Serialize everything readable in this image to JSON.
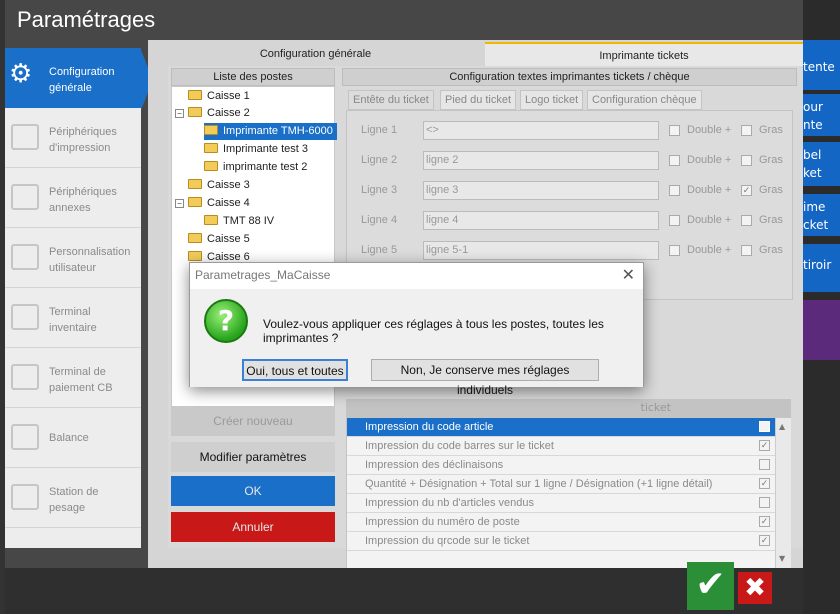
{
  "window": {
    "title": "Paramétrages"
  },
  "nav": [
    {
      "label": "Configuration générale",
      "icon": "gear-icon"
    },
    {
      "label": "Périphériques d'impression",
      "icon": "printer-icon"
    },
    {
      "label": "Périphériques annexes",
      "icon": "device-icon"
    },
    {
      "label": "Personnalisation utilisateur",
      "icon": "user-icon"
    },
    {
      "label": "Terminal inventaire",
      "icon": "terminal-icon"
    },
    {
      "label": "Terminal de paiement CB",
      "icon": "card-terminal-icon"
    },
    {
      "label": "Balance",
      "icon": "scale-icon"
    },
    {
      "label": "Station de pesage",
      "icon": "weigh-station-icon"
    }
  ],
  "tabs": {
    "tab1": "Configuration générale",
    "tab2": "Imprimante tickets"
  },
  "tree": {
    "header": "Liste des postes",
    "nodes": [
      "Caisse 1",
      "Caisse 2",
      "Imprimante TMH-6000",
      "Imprimante test 3",
      "imprimante test 2",
      "Caisse 3",
      "Caisse 4",
      "TMT 88 IV",
      "Caisse 5",
      "Caisse 6"
    ]
  },
  "buttons": {
    "create": "Créer nouveau",
    "modify": "Modifier paramètres",
    "ok": "OK",
    "cancel": "Annuler"
  },
  "config": {
    "header": "Configuration textes imprimantes tickets / chèque",
    "subtabs": [
      "Entête du ticket",
      "Pied du ticket",
      "Logo ticket",
      "Configuration chèque"
    ],
    "lines": [
      {
        "label": "Ligne 1",
        "value": "<>",
        "double": "Double +",
        "bold": "Gras",
        "bold_checked": false
      },
      {
        "label": "Ligne 2",
        "value": "ligne 2",
        "double": "Double +",
        "bold": "Gras",
        "bold_checked": false
      },
      {
        "label": "Ligne 3",
        "value": "ligne 3",
        "double": "Double +",
        "bold": "Gras",
        "bold_checked": true
      },
      {
        "label": "Ligne 4",
        "value": "ligne 4",
        "double": "Double +",
        "bold": "Gras",
        "bold_checked": false
      },
      {
        "label": "Ligne 5",
        "value": "ligne 5-1",
        "double": "Double +",
        "bold": "Gras",
        "bold_checked": false
      }
    ]
  },
  "options": {
    "header_fragment": "ticket",
    "items": [
      {
        "label": "Impression du code article",
        "checked": false
      },
      {
        "label": "Impression du code barres sur le ticket",
        "checked": true
      },
      {
        "label": "Impression des déclinaisons",
        "checked": false
      },
      {
        "label": "Quantité + Désignation + Total sur 1 ligne / Désignation (+1 ligne détail)",
        "checked": true
      },
      {
        "label": "Impression du nb d'articles vendus",
        "checked": false
      },
      {
        "label": "Impression du numéro de poste",
        "checked": true
      },
      {
        "label": "Impression du qrcode sur le ticket",
        "checked": true
      }
    ]
  },
  "dialog": {
    "title": "Parametrages_MaCaisse",
    "message": "Voulez-vous appliquer ces réglages à tous les postes, toutes les imprimantes ?",
    "yes": "Oui, tous et toutes",
    "no": "Non, Je conserve mes réglages individuels"
  },
  "right_side": {
    "frag1": "tente",
    "frag2": "our",
    "frag3": "nte",
    "frag4": "bel",
    "frag5": "ket",
    "frag6": "ime",
    "frag7": "cket",
    "frag8": "tiroir"
  },
  "colors": {
    "accent": "#1a6fc9",
    "ok": "#2a8f36",
    "cancel": "#c81818",
    "tab_highlight": "#f2b600"
  }
}
